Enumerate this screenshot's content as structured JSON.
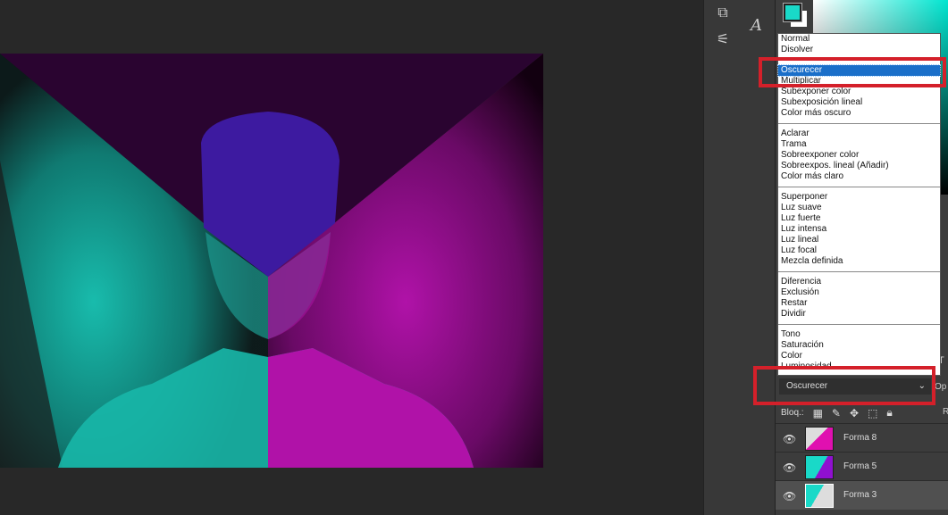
{
  "toolbar": {
    "icons": [
      "3d-icon",
      "adjust-icon",
      "character-icon"
    ],
    "char_glyph": "A"
  },
  "colors": {
    "foreground": "#19d9c8",
    "background": "#ffffff",
    "highlight": "#d4202a"
  },
  "blend_modes": {
    "groups": [
      [
        "Normal",
        "Disolver"
      ],
      [
        "Oscurecer",
        "Multiplicar",
        "Subexponer color",
        "Subexposición lineal",
        "Color más oscuro"
      ],
      [
        "Aclarar",
        "Trama",
        "Sobreexponer color",
        "Sobreexpos. lineal (Añadir)",
        "Color más claro"
      ],
      [
        "Superponer",
        "Luz suave",
        "Luz fuerte",
        "Luz intensa",
        "Luz lineal",
        "Luz focal",
        "Mezcla definida"
      ],
      [
        "Diferencia",
        "Exclusión",
        "Restar",
        "Dividir"
      ],
      [
        "Tono",
        "Saturación",
        "Color",
        "Luminosidad"
      ]
    ],
    "selected": "Oscurecer"
  },
  "layers_panel": {
    "blend_value": "Oscurecer",
    "opacity_label": "Op",
    "lock_label": "Bloq.:",
    "fill_label": "R",
    "t_label": "T",
    "layers": [
      {
        "name": "Forma 8"
      },
      {
        "name": "Forma 5"
      },
      {
        "name": "Forma 3",
        "selected": true
      }
    ]
  }
}
